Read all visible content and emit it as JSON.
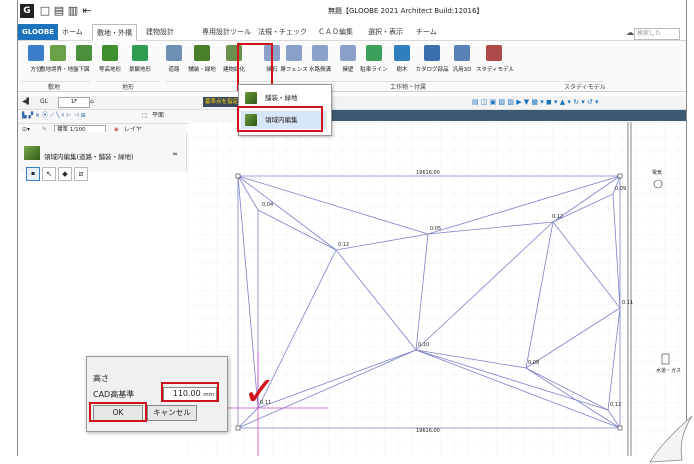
{
  "window": {
    "title": "無題【GLOOBE 2021 Architect Build:12016】",
    "quick_access": [
      "G",
      "□",
      "▤",
      "▥",
      "⇤"
    ]
  },
  "menu": {
    "logo": "GLOOBE",
    "tabs": [
      "ホーム",
      "敷地・外構",
      "建物設計",
      "専用設計ツール",
      "法規・チェック",
      "ＣＡＤ編集",
      "選択・表示",
      "チーム"
    ],
    "active_index": 1,
    "search_placeholder": "検索した"
  },
  "ribbon": {
    "buttons": [
      {
        "label": "方位",
        "icon": "compass-icon",
        "color": "#3a7dc9"
      },
      {
        "label": "敷地境界・地盤",
        "icon": "site-boundary-icon",
        "color": "#6aa046"
      },
      {
        "label": "下図",
        "icon": "underlay-icon",
        "color": "#4a8f3c"
      },
      {
        "label": "等高地形",
        "icon": "contour-icon",
        "color": "#3f8f2f"
      },
      {
        "label": "景観地形",
        "icon": "landscape-icon",
        "color": "#2f9c4f"
      },
      {
        "label": "道路",
        "icon": "road-icon",
        "color": "#6f8fb0"
      },
      {
        "label": "舗装・緑地",
        "icon": "paving-icon",
        "color": "#4a7f2a"
      },
      {
        "label": "建物緑化",
        "icon": "building-green-icon",
        "color": "#6b8f4f"
      },
      {
        "label": "縁石",
        "icon": "curb-icon",
        "color": "#8aa0c8"
      },
      {
        "label": "塀フェンス",
        "icon": "fence-icon",
        "color": "#8aa0c8"
      },
      {
        "label": "水路側溝",
        "icon": "gutter-icon",
        "color": "#8aa0c8"
      },
      {
        "label": "擁壁",
        "icon": "retaining-wall-icon",
        "color": "#8aa0c8"
      },
      {
        "label": "駐車ライン",
        "icon": "parking-icon",
        "color": "#3aa05a"
      },
      {
        "label": "樹木",
        "icon": "tree-icon",
        "color": "#2f7fbf"
      },
      {
        "label": "カタログ部品",
        "icon": "car-icon",
        "color": "#3a6fb0"
      },
      {
        "label": "汎用3D",
        "icon": "generic-3d-icon",
        "color": "#5a80b8"
      },
      {
        "label": "スタディモデル",
        "icon": "study-model-icon",
        "color": "#b04a4a"
      }
    ],
    "groups": [
      "敷地",
      "地形",
      "工作物・付属",
      "スタディモデル"
    ]
  },
  "toolbar": {
    "floor_value": "1F",
    "gl_label": "GL",
    "hint_text": "基準点を指定してください。",
    "scale_label": "標準 1/100",
    "layer_label": "レイヤ",
    "plan_label": "平面"
  },
  "panel": {
    "title": "領域内編集(道路・舗装・緑地)"
  },
  "dropdown": {
    "items": [
      "舗装・緑地",
      "領域内編集"
    ],
    "selected_index": 1
  },
  "dialog": {
    "heading": "高さ",
    "field_label": "CAD高基準",
    "value": "110.00",
    "unit": "mm",
    "ok_label": "OK",
    "cancel_label": "キャンセル"
  },
  "canvas": {
    "point_labels": [
      "0.04",
      "0.12",
      "0.05",
      "0.12",
      "0.09",
      "0.11",
      "0.10",
      "0.08",
      "0.11",
      "0.12"
    ],
    "right_labels": [
      "電気",
      "水道・ガス"
    ],
    "dimension_labels": [
      "19616.00",
      "19616.00"
    ]
  },
  "colors": {
    "accent_red": "#d0121b",
    "menu_blue": "#1e73be",
    "mesh_line": "#7b82c8",
    "hint_yellow": "#ffd400"
  }
}
